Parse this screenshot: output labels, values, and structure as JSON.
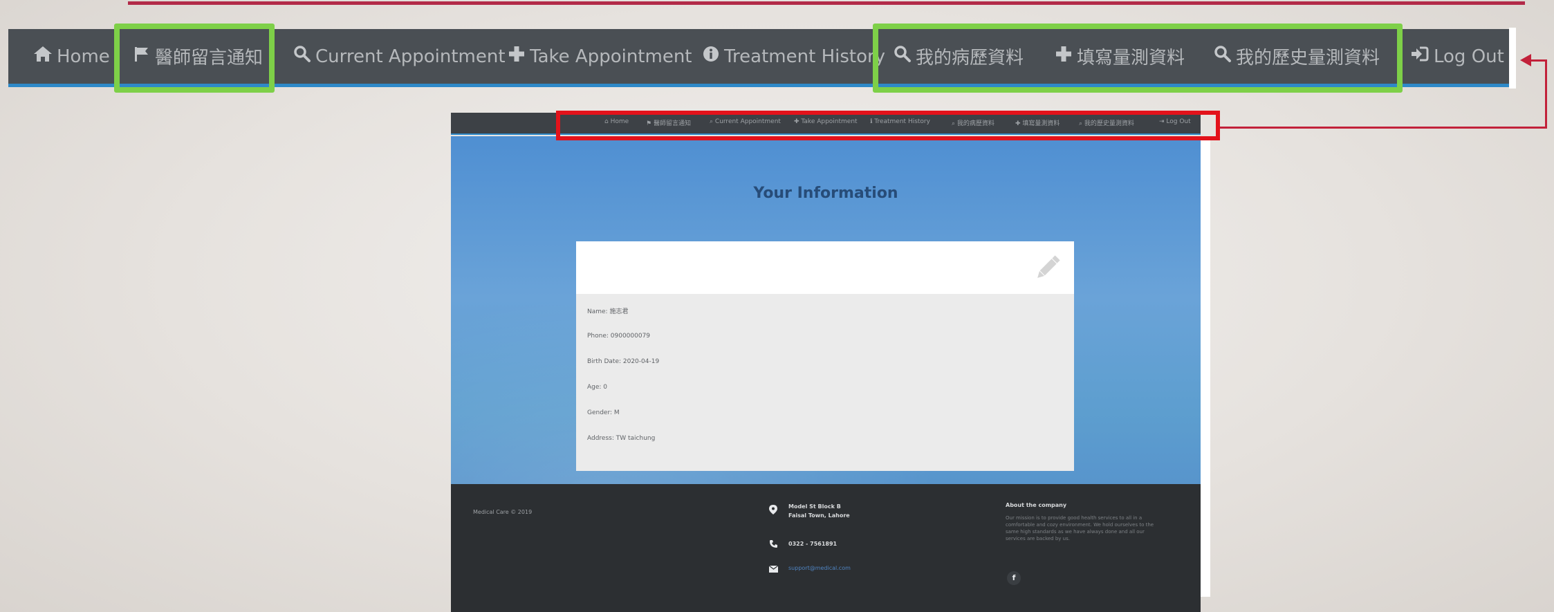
{
  "nav": {
    "home": "Home",
    "doctor_message": "醫師留言通知",
    "current_appointment": "Current Appointment",
    "take_appointment": "Take Appointment",
    "treatment_history": "Treatment History",
    "my_medical_record": "我的病歷資料",
    "fill_measurement": "填寫量測資料",
    "my_measurement_history": "我的歷史量測資料",
    "logout": "Log Out"
  },
  "page": {
    "title": "Your Information"
  },
  "info": {
    "name": "Name: 施志君",
    "phone": "Phone: 0900000079",
    "birth": "Birth Date: 2020-04-19",
    "age": "Age: 0",
    "gender": "Gender: M",
    "address": "Address: TW taichung"
  },
  "footer": {
    "brand": "Medical Care © 2019",
    "address_line1": "Model St Block B",
    "address_line2": "Faisal Town, Lahore",
    "phone": "0322 - 7561891",
    "email": "support@medical.com",
    "about_title": "About the company",
    "about_text": "Our mission is to provide good health services to all in a comfortable and cozy environment. We hold ourselves to the same high standards as we have always done and all our services are backed by us.",
    "facebook": "f"
  },
  "colors": {
    "nav_bg": "#4a4f54",
    "nav_text": "#b5b8bb",
    "highlight_green": "#7ed048",
    "highlight_red": "#e3121b",
    "accent_blue": "#2e89c8",
    "arrow": "#c2213a"
  },
  "icons": {
    "home": "home-icon",
    "flag": "flag-icon",
    "search": "search-icon",
    "plus": "plus-icon",
    "info": "info-icon",
    "logout": "sign-in-icon",
    "pencil": "pencil-icon",
    "map_marker": "map-marker-icon",
    "phone": "phone-icon",
    "envelope": "envelope-icon",
    "facebook": "facebook-icon"
  }
}
